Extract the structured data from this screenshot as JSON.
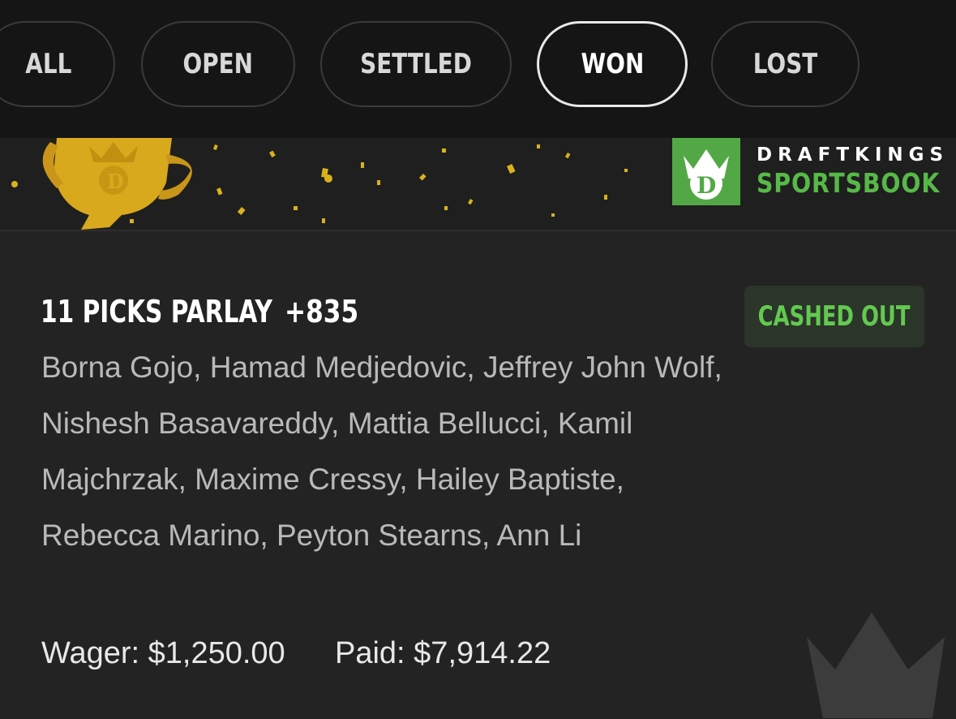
{
  "filters": {
    "tabs": [
      {
        "label": "ALL",
        "active": false
      },
      {
        "label": "OPEN",
        "active": false
      },
      {
        "label": "SETTLED",
        "active": false
      },
      {
        "label": "WON",
        "active": true
      },
      {
        "label": "LOST",
        "active": false
      }
    ]
  },
  "banner": {
    "brand_line1": "DRAFTKINGS",
    "brand_line2": "SPORTSBOOK",
    "icons": [
      "trophy-icon",
      "confetti-icon",
      "draftkings-crown-logo"
    ]
  },
  "bet": {
    "title": "11 PICKS PARLAY",
    "odds": "+835",
    "status": "CASHED OUT",
    "picks_text": "Borna Gojo, Hamad Medjedovic, Jeffrey John Wolf, Nishesh Basavareddy, Mattia Bellucci, Kamil Majchrzak, Maxime Cressy, Hailey Baptiste, Rebecca Marino, Peyton Stearns, Ann Li",
    "wager_text": "Wager: $1,250.00",
    "paid_text": "Paid: $7,914.22"
  },
  "colors": {
    "brand_green": "#53a846",
    "status_green": "#63c951",
    "trophy_gold": "#d9a91d",
    "background": "#232323",
    "tabs_background": "#151515"
  }
}
